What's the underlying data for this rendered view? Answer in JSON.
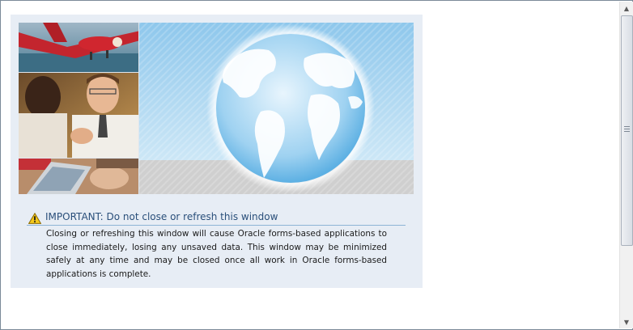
{
  "notice": {
    "icon": "warning-icon",
    "title": "IMPORTANT: Do not close or refresh this window",
    "body": "Closing or refreshing this window will cause Oracle forms-based applications to close immediately, losing any unsaved data. This window may be minimized safely at any time and may be closed once all work in Oracle forms-based applications is complete."
  },
  "hero": {
    "images": [
      "airplane-photo",
      "businessmen-photo",
      "laptop-photo",
      "globe-graphic"
    ]
  },
  "scrollbar": {
    "up_icon": "arrow-up-icon",
    "down_icon": "arrow-down-icon"
  },
  "colors": {
    "panel_bg": "#e7edf5",
    "title": "#2a4f7a",
    "rule": "#8db4d6"
  }
}
